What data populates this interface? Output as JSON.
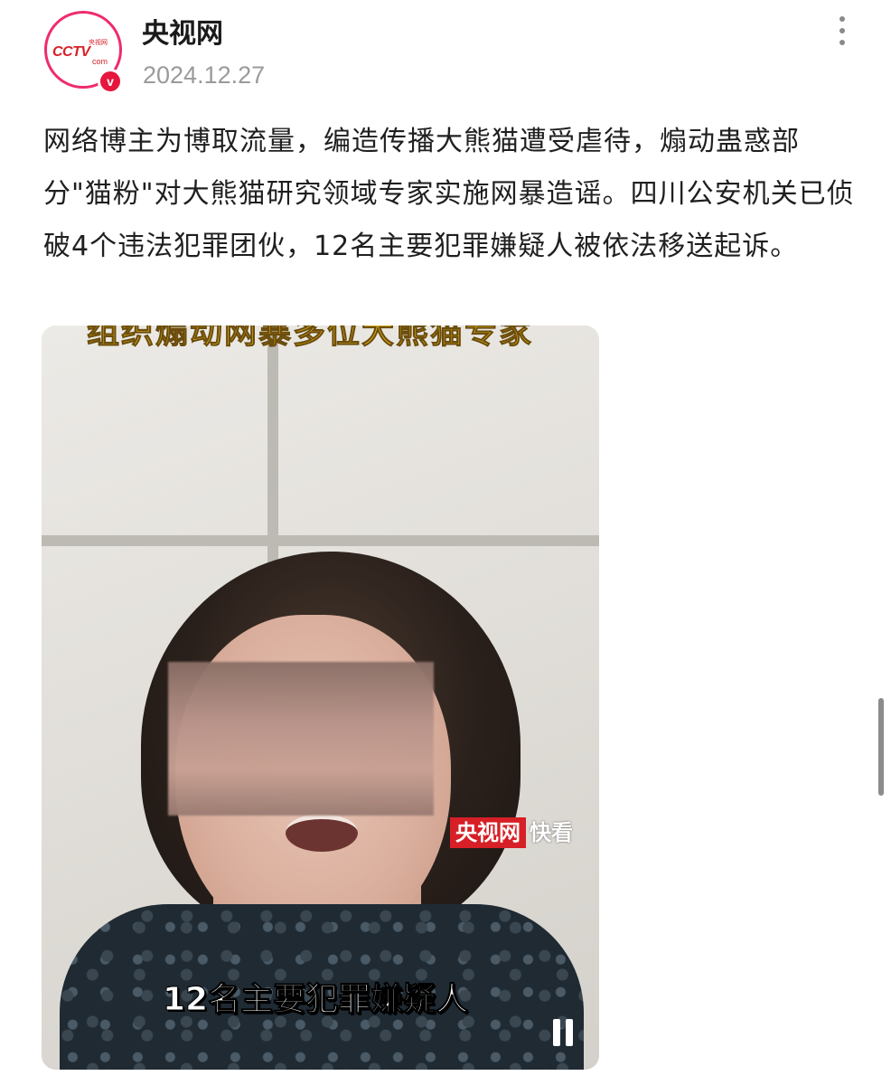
{
  "account": {
    "name": "央视网",
    "date": "2024.12.27",
    "avatar_text": "CCTV",
    "avatar_sub_text": "央视网",
    "avatar_com_text": "com",
    "verified_mark": "v"
  },
  "post": {
    "text": "网络博主为博取流量，编造传播大熊猫遭受虐待，煽动蛊惑部分\"猫粉\"对大熊猫研究领域专家实施网暴造谣。四川公安机关已侦破4个违法犯罪团伙，12名主要犯罪嫌疑人被依法移送起诉。"
  },
  "video": {
    "top_caption": "组织煽动网暴多位大熊猫专家",
    "watermark_brand": "央视网",
    "watermark_tag": "快看",
    "subtitle": "12名主要犯罪嫌疑人",
    "state": "playing"
  },
  "icons": {
    "more": "more-vertical-icon",
    "pause": "pause-icon",
    "verified": "verified-badge-icon"
  },
  "colors": {
    "avatar_ring": "#ef2b6d",
    "verified_badge": "#e6163c",
    "watermark_red": "#d61f26"
  }
}
